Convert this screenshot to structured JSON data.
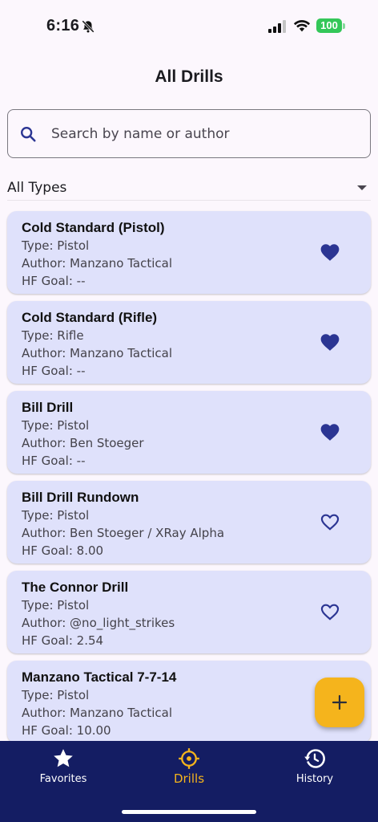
{
  "status_bar": {
    "time": "6:16",
    "battery": "100",
    "colors": {
      "battery": "#34c759"
    }
  },
  "header": {
    "title": "All Drills"
  },
  "search": {
    "placeholder": "Search by name or author",
    "value": ""
  },
  "filter": {
    "selected": "All Types"
  },
  "drills": [
    {
      "name": "Cold Standard (Pistol)",
      "type": "Type: Pistol",
      "author": "Author: Manzano Tactical",
      "goal": "HF Goal: --",
      "favorite": true
    },
    {
      "name": "Cold Standard (Rifle)",
      "type": "Type: Rifle",
      "author": "Author: Manzano Tactical",
      "goal": "HF Goal: --",
      "favorite": true
    },
    {
      "name": "Bill Drill",
      "type": "Type: Pistol",
      "author": "Author: Ben Stoeger",
      "goal": "HF Goal: --",
      "favorite": true
    },
    {
      "name": "Bill Drill Rundown",
      "type": "Type: Pistol",
      "author": "Author: Ben Stoeger / XRay Alpha",
      "goal": "HF Goal: 8.00",
      "favorite": false
    },
    {
      "name": "The Connor Drill",
      "type": "Type: Pistol",
      "author": "Author: @no_light_strikes",
      "goal": "HF Goal: 2.54",
      "favorite": false
    },
    {
      "name": "Manzano Tactical 7-7-14",
      "type": "Type: Pistol",
      "author": "Author: Manzano Tactical",
      "goal": "HF Goal: 10.00",
      "favorite": null
    }
  ],
  "fab": {
    "icon": "plus-icon"
  },
  "bottom_nav": {
    "items": [
      {
        "label": "Favorites",
        "icon": "star-icon",
        "active": false
      },
      {
        "label": "Drills",
        "icon": "crosshair-icon",
        "active": true
      },
      {
        "label": "History",
        "icon": "history-icon",
        "active": false
      }
    ]
  },
  "colors": {
    "background": "#fcf7fd",
    "card": "#dfe1fb",
    "accent": "#2b3593",
    "nav_background": "#141d63",
    "fab": "#f5b41c",
    "active_nav": "#f5b41c"
  }
}
